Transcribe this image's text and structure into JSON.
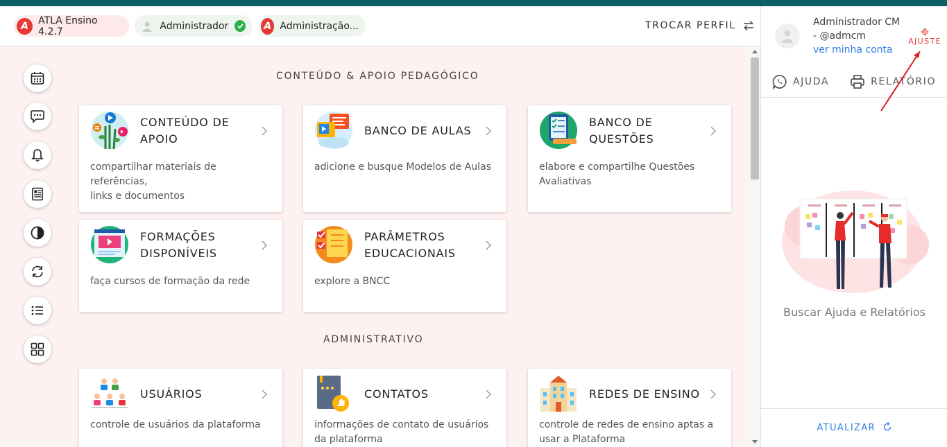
{
  "header": {
    "chips": [
      {
        "label": "ATLA Ensino 4.2.7"
      },
      {
        "label": "Administrador"
      },
      {
        "label": "Administração..."
      }
    ],
    "trocar_perfil": "TROCAR PERFIL"
  },
  "user_panel": {
    "name_line1": "Administrador CM",
    "name_line2": "- @admcm",
    "ver_minha_conta": "ver minha conta",
    "ajuste": "AJUSTE",
    "ajuda": "AJUDA",
    "relatorio": "RELATÓRIO",
    "buscar": "Buscar Ajuda e Relatórios",
    "atualizar": "ATUALIZAR"
  },
  "sidenav": [
    "calendar-icon",
    "chat-icon",
    "bell-icon",
    "news-icon",
    "contrast-icon",
    "sync-icon",
    "list-icon",
    "grid-icon"
  ],
  "sections": {
    "conteudo": "CONTEÚDO & APOIO PEDAGÓGICO",
    "administrativo": "ADMINISTRATIVO"
  },
  "cards": [
    {
      "title1": "CONTEÚDO DE",
      "title2": "APOIO",
      "desc1": "compartilhar materiais de referências,",
      "desc2": "links e documentos"
    },
    {
      "title1": "BANCO DE AULAS",
      "title2": "",
      "desc1": "adicione e busque Modelos de Aulas",
      "desc2": ""
    },
    {
      "title1": "BANCO DE",
      "title2": "QUESTÕES",
      "desc1": "elabore e compartilhe Questões",
      "desc2": "Avaliativas"
    },
    {
      "title1": "FORMAÇÕES",
      "title2": "DISPONÍVEIS",
      "desc1": "faça cursos de formação da rede",
      "desc2": ""
    },
    {
      "title1": "PARÂMETROS",
      "title2": "EDUCACIONAIS",
      "desc1": "explore a BNCC",
      "desc2": ""
    },
    {
      "title1": "USUÁRIOS",
      "title2": "",
      "desc1": "controle de usuários da plataforma",
      "desc2": ""
    },
    {
      "title1": "CONTATOS",
      "title2": "",
      "desc1": "informações de contato de usuários",
      "desc2": "da plataforma"
    },
    {
      "title1": "REDES DE ENSINO",
      "title2": "",
      "desc1": "controle de redes de ensino aptas a",
      "desc2": "usar a Plataforma"
    }
  ],
  "colors": {
    "topbar": "#0c5e67",
    "accent_red": "#e53935",
    "link_blue": "#2f7fe0",
    "background": "#fdf1f1"
  }
}
